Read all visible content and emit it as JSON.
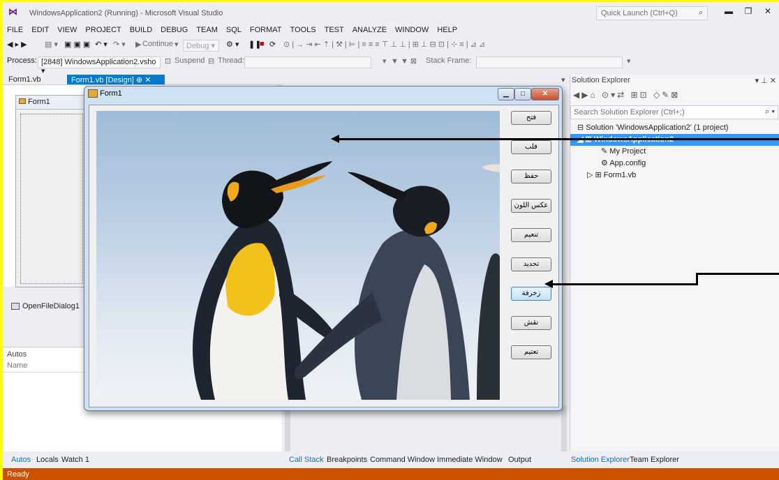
{
  "window": {
    "title": "WindowsApplication2 (Running) - Microsoft Visual Studio",
    "quick_launch_placeholder": "Quick Launch (Ctrl+Q)",
    "controls": [
      "minimize",
      "restore",
      "close"
    ]
  },
  "menu": [
    "FILE",
    "EDIT",
    "VIEW",
    "PROJECT",
    "BUILD",
    "DEBUG",
    "TEAM",
    "SQL",
    "FORMAT",
    "TOOLS",
    "TEST",
    "ANALYZE",
    "WINDOW",
    "HELP"
  ],
  "toolbar": {
    "continue_label": "Continue",
    "config_value": "Debug",
    "process_label": "Process:",
    "process_value": "[2848] WindowsApplication2.vsho",
    "suspend_label": "Suspend",
    "thread_label": "Thread:",
    "stack_frame_label": "Stack Frame:"
  },
  "doc_tabs": [
    {
      "label": "Form1.vb",
      "active": false
    },
    {
      "label": "Form1.vb [Design]",
      "active": true
    }
  ],
  "designer": {
    "form_title": "Form1",
    "tray_item": "OpenFileDialog1"
  },
  "autos": {
    "title": "Autos",
    "column_name": "Name"
  },
  "bottom_tabs_left": [
    "Autos",
    "Locals",
    "Watch 1"
  ],
  "bottom_tabs_mid": [
    "Call Stack",
    "Breakpoints",
    "Command Window",
    "Immediate Window",
    "Output"
  ],
  "bottom_tabs_right": [
    "Solution Explorer",
    "Team Explorer"
  ],
  "solution_explorer": {
    "title": "Solution Explorer",
    "search_placeholder": "Search Solution Explorer (Ctrl+;)",
    "tree": [
      {
        "label": "Solution 'WindowsApplication2' (1 project)",
        "selected": false
      },
      {
        "label": "WindowsApplication2",
        "selected": true
      },
      {
        "label": "My Project",
        "selected": false
      },
      {
        "label": "App.config",
        "selected": false
      },
      {
        "label": "Form1.vb",
        "selected": false
      }
    ]
  },
  "running_form": {
    "title": "Form1",
    "buttons": [
      "فتح",
      "قلب",
      "حفظ",
      "عكس اللون",
      "تنعيم",
      "تحديد",
      "زخرفة",
      "نقش",
      "تعتيم"
    ],
    "focused_button": "زخرفة"
  },
  "status": {
    "text": "Ready",
    "color": "#ca5100"
  },
  "colors": {
    "accent": "#007acc",
    "border_highlight": "#ffff00"
  }
}
